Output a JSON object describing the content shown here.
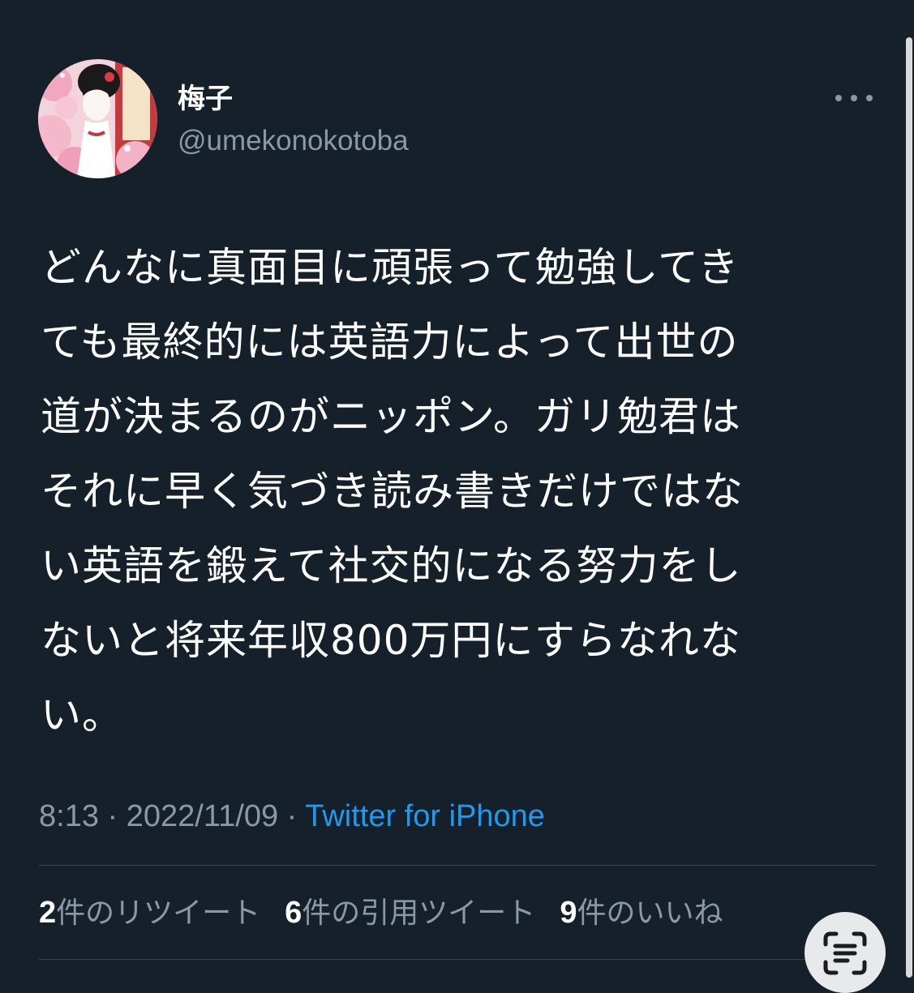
{
  "author": {
    "display_name": "梅子",
    "handle": "@umekonokotoba",
    "avatar_icon": "avatar-illustration-icon"
  },
  "more_icon": "more-horizontal-icon",
  "tweet": {
    "text": "どんなに真面目に頑張って勉強してき\nても最終的には英語力によって出世の\n道が決まるのがニッポン。ガリ勉君は\nそれに早く気づき読み書きだけではな\nい英語を鍛えて社交的になる努力をし\nないと将来年収800万円にすらなれな\nい。",
    "time": "8:13",
    "separator": " · ",
    "date": "2022/11/09",
    "source": "Twitter for iPhone"
  },
  "stats": [
    {
      "count": "2",
      "label": "件のリツイート"
    },
    {
      "count": "6",
      "label": "件の引用ツイート"
    },
    {
      "count": "9",
      "label": "件のいいね"
    }
  ],
  "scan_icon": "live-text-scan-icon",
  "colors": {
    "background": "#15202b",
    "text": "#ffffff",
    "secondary_text": "#8b98a5",
    "link": "#1d9bf0",
    "divider": "#38444d"
  }
}
